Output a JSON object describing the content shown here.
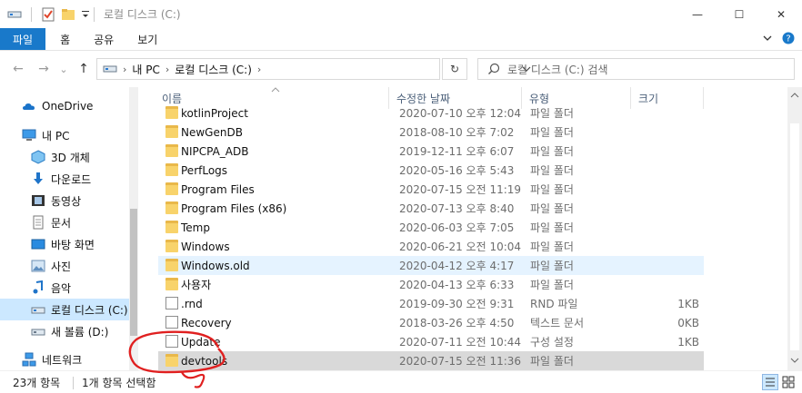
{
  "window": {
    "title": "로컬 디스크 (C:)",
    "minimize": "—",
    "maximize": "☐",
    "close": "✕"
  },
  "ribbon": {
    "tabs": [
      {
        "label": "파일"
      },
      {
        "label": "홈"
      },
      {
        "label": "공유"
      },
      {
        "label": "보기"
      }
    ]
  },
  "nav": {
    "back": "←",
    "forward": "→",
    "recent": "⌄",
    "up": "↑",
    "breadcrumb": [
      "내 PC",
      "로컬 디스크 (C:)"
    ],
    "refresh": "↻",
    "search_placeholder": "로컬 디스크 (C:) 검색"
  },
  "sidebar": {
    "items": [
      {
        "label": "OneDrive",
        "icon": "cloud-icon"
      },
      {
        "label": "내 PC",
        "icon": "pc-icon"
      },
      {
        "label": "3D 개체",
        "icon": "cube-icon"
      },
      {
        "label": "다운로드",
        "icon": "download-icon"
      },
      {
        "label": "동영상",
        "icon": "video-icon"
      },
      {
        "label": "문서",
        "icon": "document-icon"
      },
      {
        "label": "바탕 화면",
        "icon": "desktop-icon"
      },
      {
        "label": "사진",
        "icon": "picture-icon"
      },
      {
        "label": "음악",
        "icon": "music-icon"
      },
      {
        "label": "로컬 디스크 (C:)",
        "icon": "drive-icon"
      },
      {
        "label": "새 볼륨 (D:)",
        "icon": "drive-icon"
      },
      {
        "label": "네트워크",
        "icon": "network-icon"
      }
    ]
  },
  "columns": {
    "name": "이름",
    "date": "수정한 날짜",
    "type": "유형",
    "size": "크기"
  },
  "files": [
    {
      "name": "kotlinProject",
      "date": "2020-07-10 오후 12:04",
      "type": "파일 폴더",
      "size": "",
      "kind": "folder"
    },
    {
      "name": "NewGenDB",
      "date": "2018-08-10 오후 7:02",
      "type": "파일 폴더",
      "size": "",
      "kind": "folder"
    },
    {
      "name": "NIPCPA_ADB",
      "date": "2019-12-11 오후 6:07",
      "type": "파일 폴더",
      "size": "",
      "kind": "folder"
    },
    {
      "name": "PerfLogs",
      "date": "2020-05-16 오후 5:43",
      "type": "파일 폴더",
      "size": "",
      "kind": "folder"
    },
    {
      "name": "Program Files",
      "date": "2020-07-15 오전 11:19",
      "type": "파일 폴더",
      "size": "",
      "kind": "folder"
    },
    {
      "name": "Program Files (x86)",
      "date": "2020-07-13 오후 8:40",
      "type": "파일 폴더",
      "size": "",
      "kind": "folder"
    },
    {
      "name": "Temp",
      "date": "2020-06-03 오후 7:05",
      "type": "파일 폴더",
      "size": "",
      "kind": "folder"
    },
    {
      "name": "Windows",
      "date": "2020-06-21 오전 10:04",
      "type": "파일 폴더",
      "size": "",
      "kind": "folder"
    },
    {
      "name": "Windows.old",
      "date": "2020-04-12 오후 4:17",
      "type": "파일 폴더",
      "size": "",
      "kind": "folder"
    },
    {
      "name": "사용자",
      "date": "2020-04-13 오후 6:33",
      "type": "파일 폴더",
      "size": "",
      "kind": "folder"
    },
    {
      "name": ".rnd",
      "date": "2019-09-30 오전 9:31",
      "type": "RND 파일",
      "size": "1KB",
      "kind": "file"
    },
    {
      "name": "Recovery",
      "date": "2018-03-26 오후 4:50",
      "type": "텍스트 문서",
      "size": "0KB",
      "kind": "file"
    },
    {
      "name": "Update",
      "date": "2020-07-11 오전 10:44",
      "type": "구성 설정",
      "size": "1KB",
      "kind": "config"
    },
    {
      "name": "devtools",
      "date": "2020-07-15 오전 11:36",
      "type": "파일 폴더",
      "size": "",
      "kind": "folder"
    }
  ],
  "status": {
    "item_count": "23개 항목",
    "selection": "1개 항목 선택함"
  },
  "colors": {
    "accent": "#1979ca",
    "selected_nav": "#cce8ff",
    "hover_row": "#e5f3ff",
    "selected_row": "#d9d9d9",
    "annotation": "#e02020"
  }
}
